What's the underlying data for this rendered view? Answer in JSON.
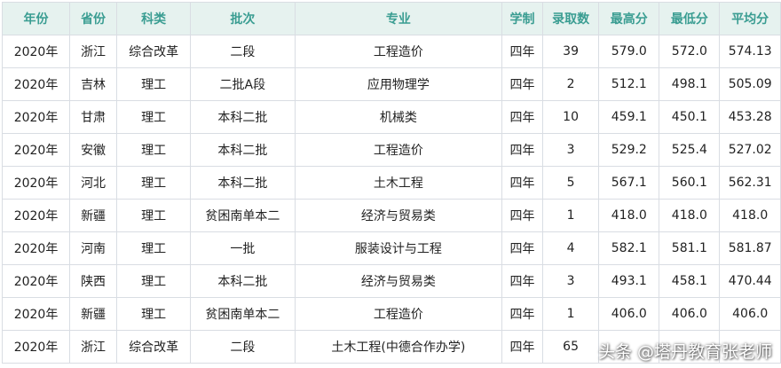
{
  "colors": {
    "header_bg": "#e6f2ef",
    "header_text": "#3a9d92",
    "border": "#d9dde3",
    "cell_text": "#222222"
  },
  "table": {
    "headers": [
      "年份",
      "省份",
      "科类",
      "批次",
      "专业",
      "学制",
      "录取数",
      "最高分",
      "最低分",
      "平均分"
    ],
    "rows": [
      [
        "2020年",
        "浙江",
        "综合改革",
        "二段",
        "工程造价",
        "四年",
        "39",
        "579.0",
        "572.0",
        "574.13"
      ],
      [
        "2020年",
        "吉林",
        "理工",
        "二批A段",
        "应用物理学",
        "四年",
        "2",
        "512.1",
        "498.1",
        "505.09"
      ],
      [
        "2020年",
        "甘肃",
        "理工",
        "本科二批",
        "机械类",
        "四年",
        "10",
        "459.1",
        "450.1",
        "453.28"
      ],
      [
        "2020年",
        "安徽",
        "理工",
        "本科二批",
        "工程造价",
        "四年",
        "3",
        "529.2",
        "525.4",
        "527.02"
      ],
      [
        "2020年",
        "河北",
        "理工",
        "本科二批",
        "土木工程",
        "四年",
        "5",
        "567.1",
        "560.1",
        "562.31"
      ],
      [
        "2020年",
        "新疆",
        "理工",
        "贫困南单本二",
        "经济与贸易类",
        "四年",
        "1",
        "418.0",
        "418.0",
        "418.0"
      ],
      [
        "2020年",
        "河南",
        "理工",
        "一批",
        "服装设计与工程",
        "四年",
        "4",
        "582.1",
        "581.1",
        "581.87"
      ],
      [
        "2020年",
        "陕西",
        "理工",
        "本科二批",
        "经济与贸易类",
        "四年",
        "3",
        "493.1",
        "458.1",
        "470.44"
      ],
      [
        "2020年",
        "新疆",
        "理工",
        "贫困南单本二",
        "工程造价",
        "四年",
        "1",
        "406.0",
        "406.0",
        "406.0"
      ],
      [
        "2020年",
        "浙江",
        "综合改革",
        "二段",
        "土木工程(中德合作办学)",
        "四年",
        "65",
        "",
        "",
        ""
      ]
    ]
  },
  "watermark": "头条 @塔丹教育张老师"
}
